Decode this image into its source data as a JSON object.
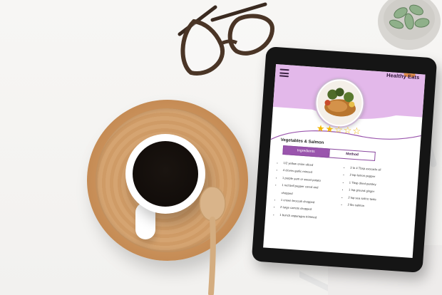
{
  "app": {
    "logo": "Healthy Eats"
  },
  "recipe": {
    "title": "Vegetables & Salmon",
    "rating": 2,
    "rating_max": 5,
    "tabs": [
      {
        "label": "Ingredients",
        "active": true
      },
      {
        "label": "Method",
        "active": false
      }
    ],
    "ingredients_left": [
      "1/2 yellow onion sliced",
      "4 cloves garlic minced",
      "1 purple yam or sweet potato",
      "1 red bell pepper cored and",
      "chopped",
      "1 crown broccoli chopped",
      "2 large carrots chopped",
      "1 bunch asparagus trimmed"
    ],
    "ingredients_right": [
      "3 to 4 Tbsp avocado oil",
      "2 tsp lemon pepper",
      "1 Tbsp dried parsley",
      "1 tsp ground ginger",
      "2 tsp sea salt to taste",
      "2 lbs salmon"
    ]
  },
  "colors": {
    "brand_pink": "#e3b8ea",
    "tab_purple": "#9a55ad",
    "star_gold": "#f2b705"
  },
  "icons": [
    "menu-icon",
    "star-icon"
  ]
}
